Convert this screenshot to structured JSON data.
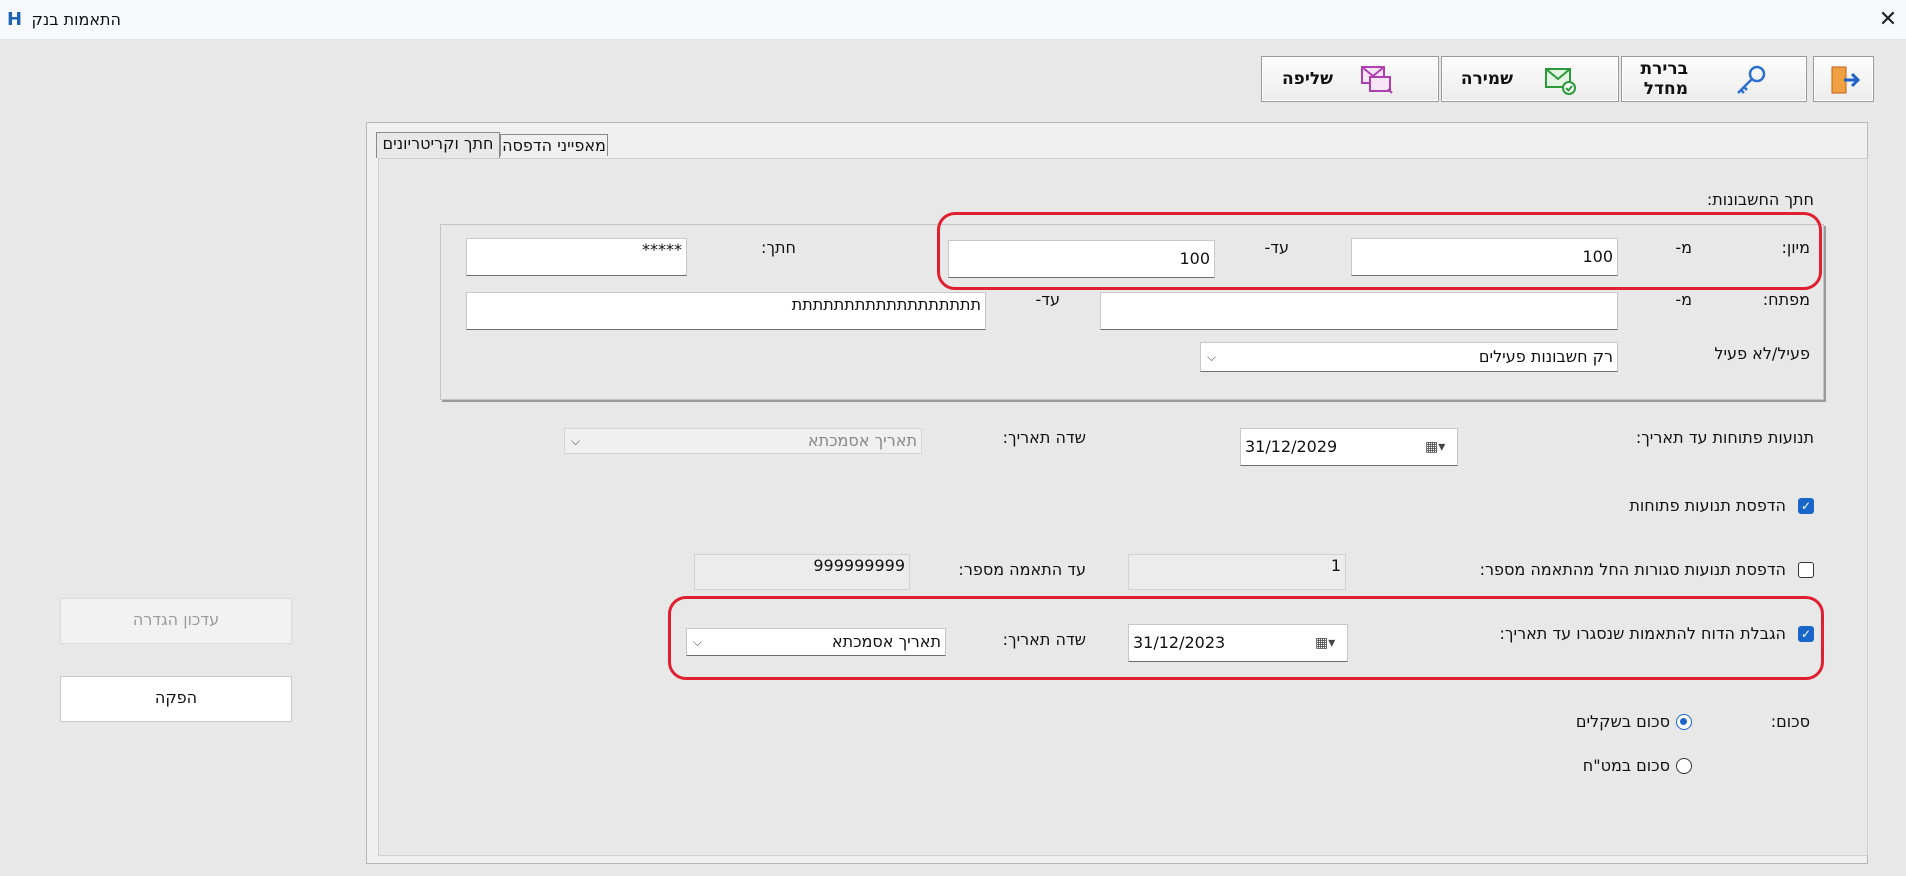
{
  "window": {
    "title": "התאמות בנק",
    "app_icon": "H"
  },
  "toolbar": {
    "exit": "exit-door-icon",
    "defaults_label_1": "ברירת",
    "defaults_label_2": "מחדל",
    "save_label": "שמירה",
    "load_label": "שליפה"
  },
  "tabs": [
    {
      "label": "חתך וקריטריונים",
      "active": true
    },
    {
      "label": "מאפייני הדפסה",
      "active": false
    }
  ],
  "section": {
    "accounts_cut": "חתך החשבונות:",
    "sort_label": "מיון:",
    "from_label": "מ-",
    "to_label": "עד-",
    "sort_from": "100",
    "sort_to": "100",
    "cut_label": "חתך:",
    "cut_value": "*****",
    "key_label": "מפתח:",
    "key_from_label": "מ-",
    "key_to_label": "עד-",
    "key_from": "",
    "key_to": "תתתתתתתתתתתתתתתתתת",
    "active_label": "פעיל/לא פעיל",
    "active_value": "רק חשבונות פעילים"
  },
  "open_moves": {
    "label": "תנועות פתוחות עד תאריך:",
    "date": "31/12/2029",
    "date_field_label": "שדה תאריך:",
    "date_field_value": "תאריך אסמכתא"
  },
  "print_open": {
    "label": "הדפסת תנועות פתוחות",
    "checked": true
  },
  "print_closed": {
    "label": "הדפסת תנועות סגורות החל מהתאמה מספר:",
    "checked": false,
    "from_value": "1",
    "to_label": "עד התאמה מספר:",
    "to_value": "999999999"
  },
  "limit_report": {
    "label": "הגבלת הדוח להתאמות שנסגרו עד תאריך:",
    "checked": true,
    "date": "31/12/2023",
    "date_field_label": "שדה תאריך:",
    "date_field_value": "תאריך אסמכתא"
  },
  "amount": {
    "label": "סכום:",
    "opt_ils": "סכום בשקלים",
    "opt_fx": "סכום במט\"ח",
    "selected": "ils"
  },
  "side": {
    "update_label": "עדכון הגדרה",
    "produce_label": "הפקה"
  },
  "colors": {
    "highlight": "#e02030",
    "accent": "#1a66c8"
  }
}
